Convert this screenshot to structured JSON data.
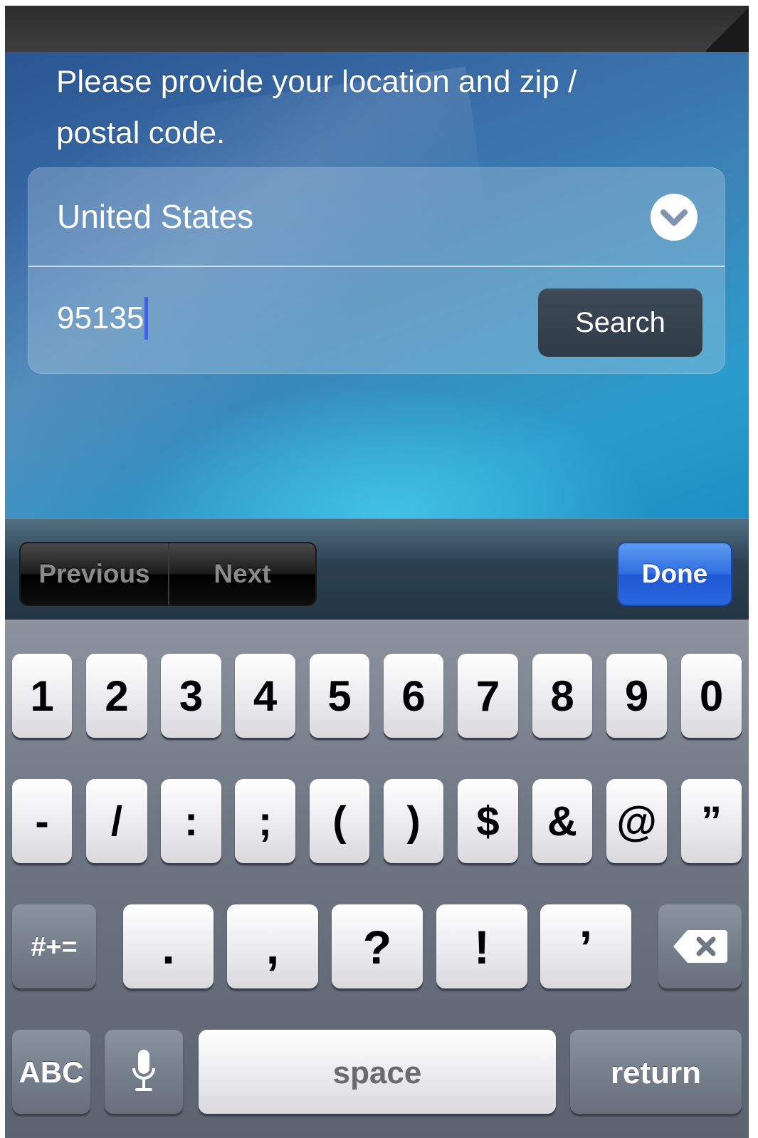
{
  "form": {
    "instructions_line1": "Please provide your location and zip /",
    "instructions_line2": "postal code.",
    "country": "United States",
    "zip_value": "95135",
    "search_label": "Search"
  },
  "toolbar": {
    "previous_label": "Previous",
    "next_label": "Next",
    "done_label": "Done"
  },
  "keyboard": {
    "row1": [
      "1",
      "2",
      "3",
      "4",
      "5",
      "6",
      "7",
      "8",
      "9",
      "0"
    ],
    "row2": [
      "-",
      "/",
      ":",
      ";",
      "(",
      ")",
      "$",
      "&",
      "@",
      "”"
    ],
    "row3_mode": "#+=",
    "row3": [
      ".",
      ",",
      "?",
      "!",
      "’"
    ],
    "abc_label": "ABC",
    "space_label": "space",
    "return_label": "return"
  },
  "icons": {
    "dropdown": "chevron-down-icon",
    "dictation": "microphone-icon",
    "delete": "backspace-icon"
  },
  "colors": {
    "done_button": "#2f6de0",
    "cursor": "#3c5cff",
    "search_button": "#34414d"
  }
}
